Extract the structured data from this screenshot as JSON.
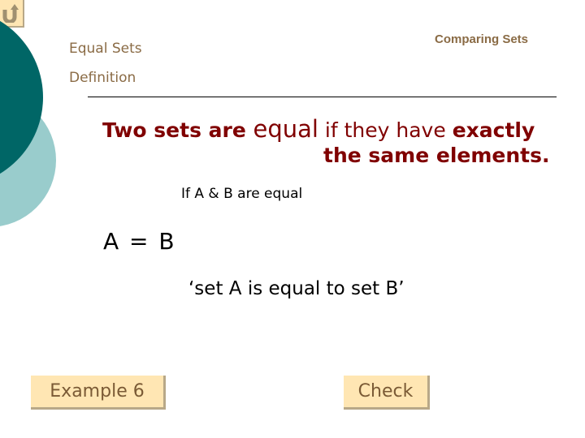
{
  "header": {
    "title": "Equal Sets",
    "subtitle": "Definition",
    "section": "Comparing Sets"
  },
  "definition": {
    "part1": "Two sets are ",
    "part2": "equal",
    "part3": " if they have ",
    "part4": "exactly",
    "line2": "the same elements."
  },
  "condition": "If A & B are equal",
  "notation": "A = B",
  "reading": "‘set A is equal to set B’",
  "buttons": {
    "return_icon": "return-arrow-icon",
    "example": "Example 6",
    "check": "Check"
  },
  "colors": {
    "dark_teal": "#006666",
    "light_teal": "#99cccc",
    "maroon": "#800000",
    "heading_brown": "#8a6b45",
    "button_bg": "#ffe6b3"
  }
}
